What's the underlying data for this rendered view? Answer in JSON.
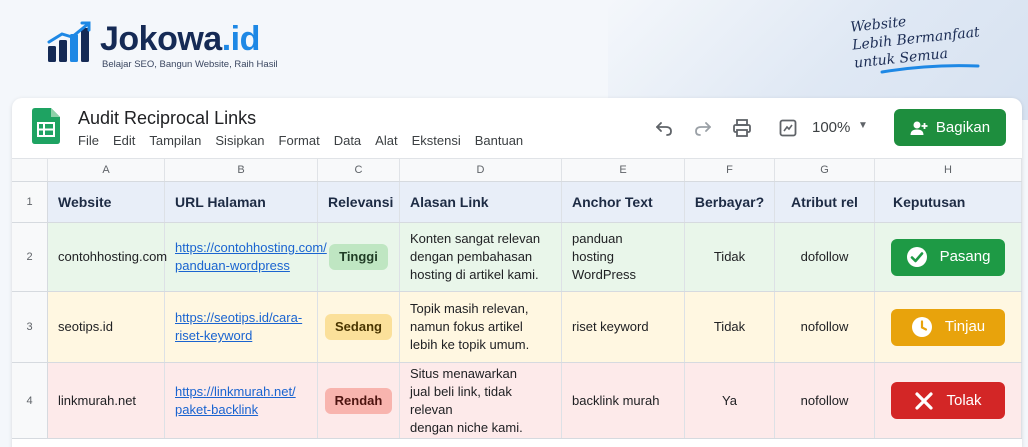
{
  "brand": {
    "name_main": "Jokowa",
    "name_tld": ".id",
    "tagline": "Belajar SEO, Bangun Website, Raih Hasil",
    "slogan": [
      "Website",
      "Lebih Bermanfaat",
      "untuk Semua"
    ]
  },
  "sheet": {
    "title": "Audit Reciprocal Links",
    "menu": [
      "File",
      "Edit",
      "Tampilan",
      "Sisipkan",
      "Format",
      "Data",
      "Alat",
      "Ekstensi",
      "Bantuan"
    ],
    "zoom": "100%",
    "share_label": "Bagikan",
    "columns": [
      "A",
      "B",
      "C",
      "D",
      "E",
      "F",
      "G",
      "H"
    ],
    "headers": [
      "Website",
      "URL Halaman",
      "Relevansi",
      "Alasan Link",
      "Anchor Text",
      "Berbayar?",
      "Atribut rel",
      "Keputusan"
    ],
    "rows": [
      {
        "num": "2",
        "website": "contohhosting.com",
        "url": [
          "https://contohhosting.com/",
          "panduan-wordpress"
        ],
        "relevance": "Tinggi",
        "reason": [
          "Konten sangat relevan",
          "dengan pembahasan",
          "hosting di artikel kami."
        ],
        "anchor": [
          "panduan",
          "hosting WordPress"
        ],
        "paid": "Tidak",
        "rel": "dofollow",
        "decision": "Pasang"
      },
      {
        "num": "3",
        "website": "seotips.id",
        "url": [
          "https://seotips.id/cara-",
          "riset-keyword"
        ],
        "relevance": "Sedang",
        "reason": [
          "Topik masih relevan,",
          "namun fokus artikel",
          "lebih ke topik umum."
        ],
        "anchor": [
          "riset keyword"
        ],
        "paid": "Tidak",
        "rel": "nofollow",
        "decision": "Tinjau"
      },
      {
        "num": "4",
        "website": "linkmurah.net",
        "url": [
          "https://linkmurah.net/",
          "paket-backlink"
        ],
        "relevance": "Rendah",
        "reason": [
          "Situs menawarkan",
          "jual beli link, tidak relevan",
          "dengan niche kami."
        ],
        "anchor": [
          "backlink murah"
        ],
        "paid": "Ya",
        "rel": "nofollow",
        "decision": "Tolak"
      }
    ]
  },
  "colors": {
    "brand_navy": "#152a55",
    "brand_blue": "#1e88e5",
    "share_green": "#1e8e3e",
    "row_high_bg": "#e9f6ea",
    "row_mid_bg": "#fff7e1",
    "row_low_bg": "#fdeaea",
    "pill_high": "#bfe6c2",
    "pill_mid": "#fbe09a",
    "pill_low": "#f8b4ae",
    "decision_pasang": "#1e9a45",
    "decision_tinjau": "#e8a30c",
    "decision_tolak": "#d32626"
  },
  "icons": {
    "undo": "undo-icon",
    "redo": "redo-icon",
    "print": "print-icon",
    "format_paint": "format-icon",
    "share": "person-add-icon",
    "pasang": "check-circle-icon",
    "tinjau": "clock-icon",
    "tolak": "x-icon"
  }
}
